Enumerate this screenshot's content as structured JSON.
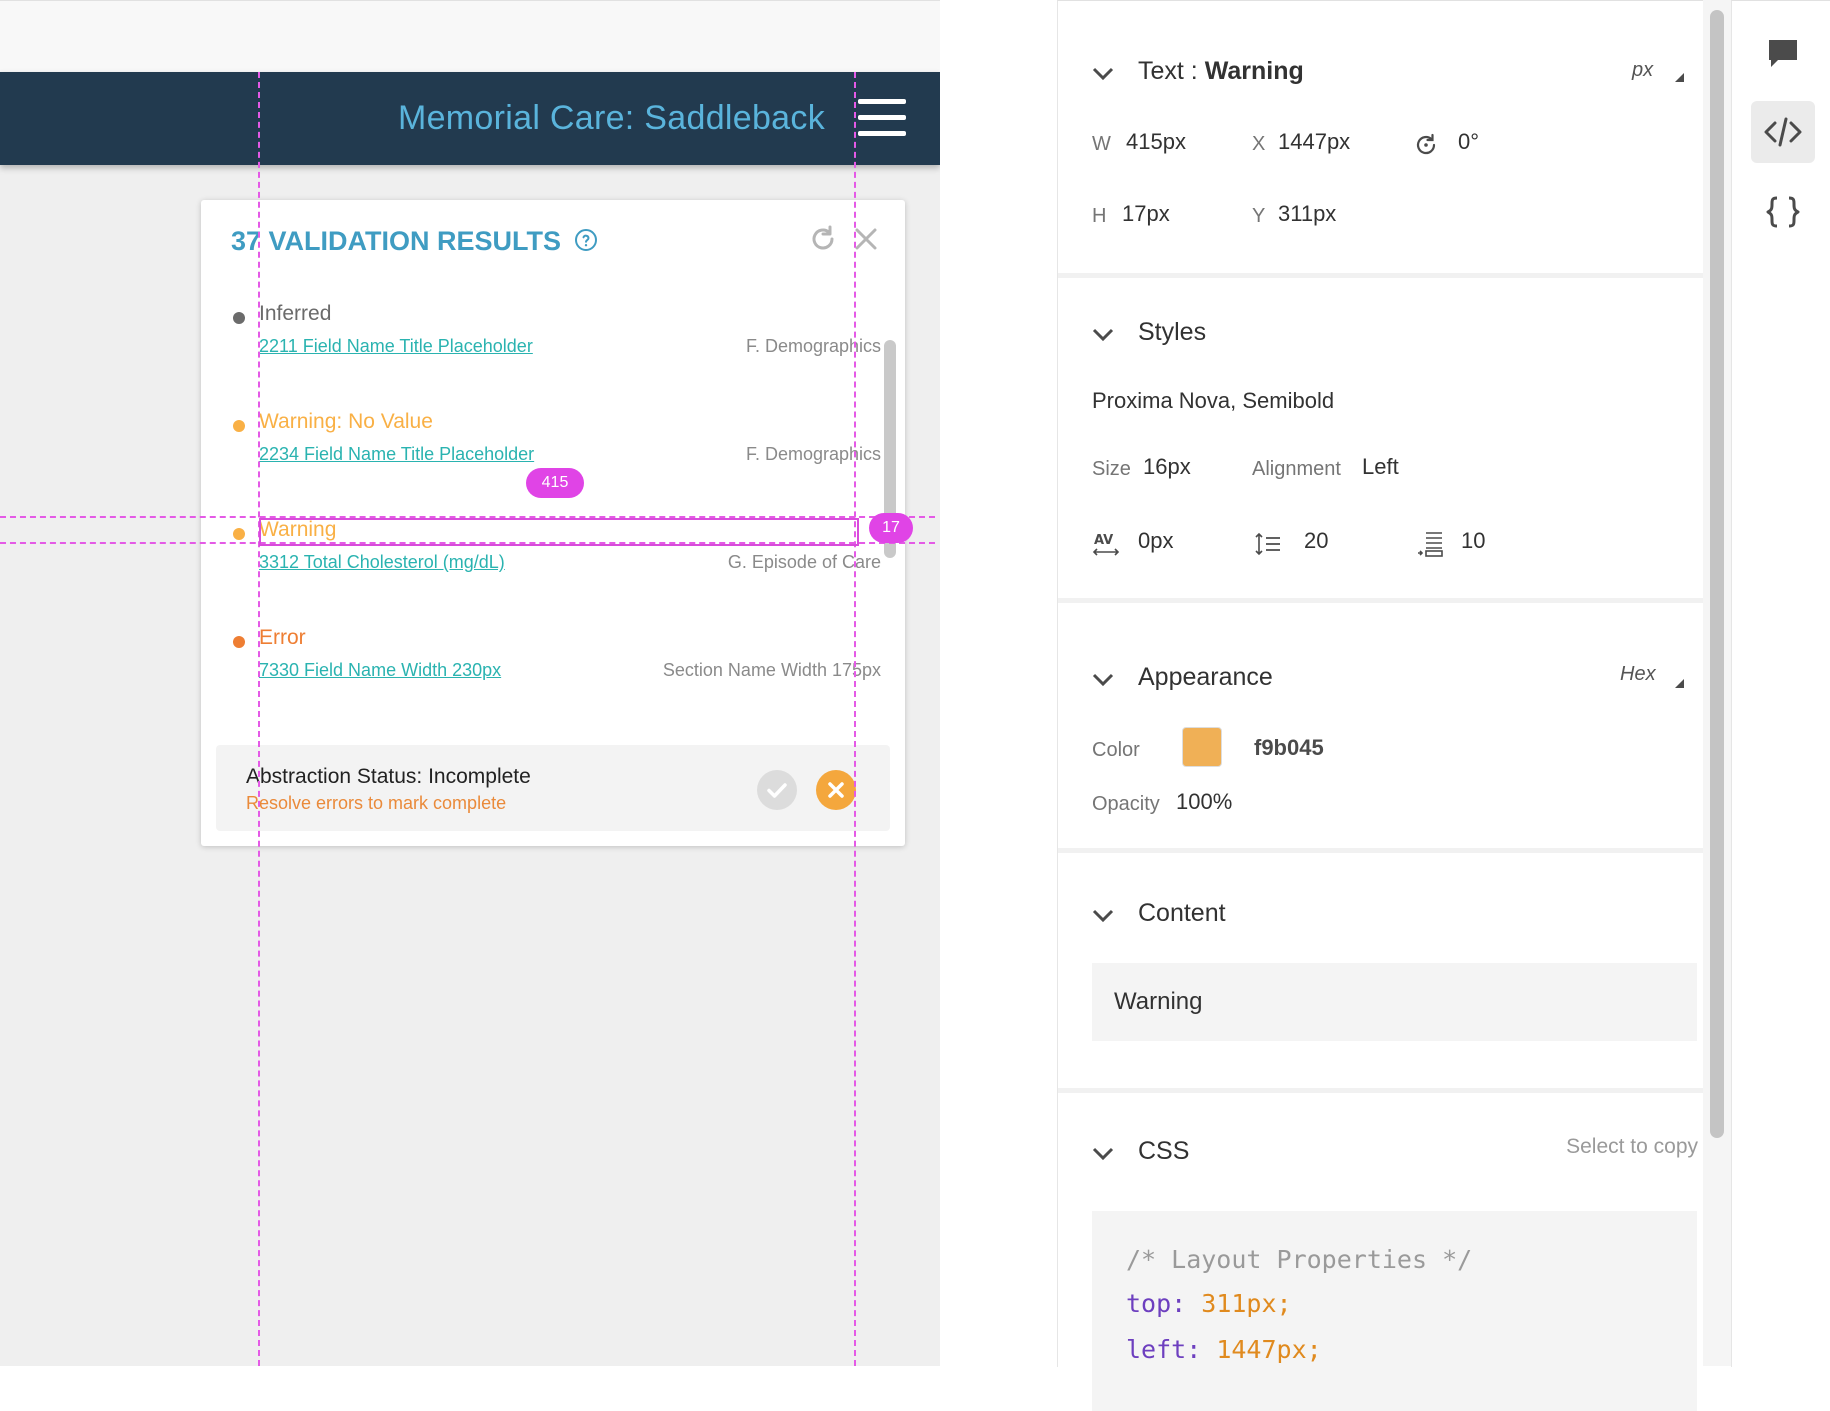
{
  "app": {
    "title": "Memorial Care: Saddleback",
    "menu_icon": "hamburger-menu-icon"
  },
  "panel": {
    "title": "37 VALIDATION RESULTS",
    "help_icon": "help-circle-icon",
    "refresh_icon": "refresh-icon",
    "close_icon": "close-icon",
    "results": [
      {
        "label": "Inferred",
        "status": "inferred",
        "color": "#6b6b6b",
        "field": "2211 Field Name Title Placeholder",
        "section": "F. Demographics"
      },
      {
        "label": "Warning: No Value",
        "status": "warning",
        "color": "#f9b045",
        "field": "2234 Field Name Title Placeholder",
        "section": "F. Demographics"
      },
      {
        "label": "Warning",
        "status": "warning",
        "color": "#f9b045",
        "field": "3312 Total Cholesterol (mg/dL)",
        "section": "G. Episode of Care"
      },
      {
        "label": "Error",
        "status": "error",
        "color": "#ee7e33",
        "field": "7330 Field Name Width 230px",
        "section": "Section Name Width 175px"
      }
    ],
    "status": {
      "title": "Abstraction Status: Incomplete",
      "subtitle": "Resolve errors to mark complete",
      "complete_icon": "check-icon",
      "reject_icon": "x-icon"
    }
  },
  "measurements": {
    "width_badge": "415",
    "height_badge": "17"
  },
  "inspector": {
    "text_section": {
      "heading_prefix": "Text : ",
      "heading_name": "Warning",
      "unit": "px",
      "w_label": "W",
      "w_value": "415px",
      "x_label": "X",
      "x_value": "1447px",
      "rotation_icon": "rotate-icon",
      "rotation_value": "0°",
      "h_label": "H",
      "h_value": "17px",
      "y_label": "Y",
      "y_value": "311px"
    },
    "styles_section": {
      "heading": "Styles",
      "font": "Proxima Nova, Semibold",
      "size_label": "Size",
      "size_value": "16px",
      "alignment_label": "Alignment",
      "alignment_value": "Left",
      "tracking_icon": "character-spacing-icon",
      "tracking_value": "0px",
      "line_spacing_icon": "line-spacing-icon",
      "line_spacing_value": "20",
      "paragraph_spacing_icon": "paragraph-spacing-icon",
      "paragraph_spacing_value": "10"
    },
    "appearance_section": {
      "heading": "Appearance",
      "color_format": "Hex",
      "color_label": "Color",
      "color_value": "f9b045",
      "swatch": "#f0b056",
      "opacity_label": "Opacity",
      "opacity_value": "100%"
    },
    "content_section": {
      "heading": "Content",
      "value": "Warning"
    },
    "css_section": {
      "heading": "CSS",
      "hint": "Select to copy",
      "lines": [
        {
          "text": "/* Layout Properties */",
          "kind": "comment"
        },
        {
          "prop": "top",
          "value": "311px;"
        },
        {
          "prop": "left",
          "value": "1447px;"
        }
      ]
    }
  },
  "tools": [
    {
      "icon": "comment-icon",
      "active": false
    },
    {
      "icon": "code-icon",
      "active": true
    },
    {
      "icon": "braces-icon",
      "active": false
    }
  ]
}
